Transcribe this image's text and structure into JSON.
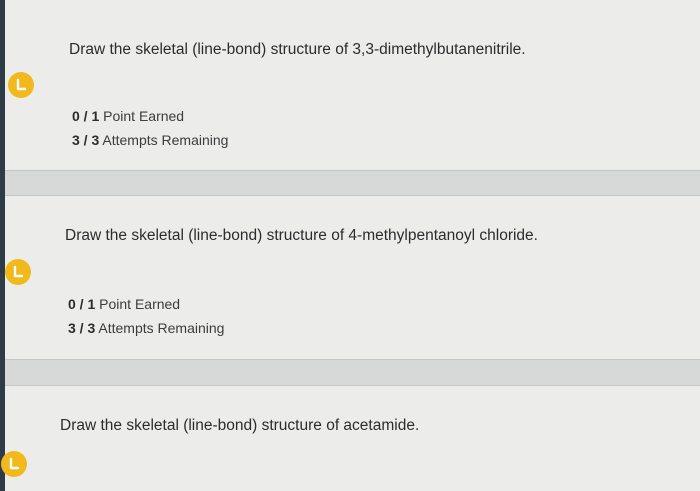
{
  "questions": [
    {
      "prompt": "Draw the skeletal (line-bond) structure of 3,3-dimethylbutanenitrile.",
      "points_value": "0 / 1",
      "points_label": "Point Earned",
      "attempts_value": "3 / 3",
      "attempts_label": "Attempts Remaining"
    },
    {
      "prompt": "Draw the skeletal (line-bond) structure of 4-methylpentanoyl chloride.",
      "points_value": "0 / 1",
      "points_label": "Point Earned",
      "attempts_value": "3 / 3",
      "attempts_label": "Attempts Remaining"
    },
    {
      "prompt": "Draw the skeletal (line-bond) structure of acetamide."
    }
  ],
  "badge_color": "#f2b91c",
  "badge_icon": "corner-l-icon"
}
